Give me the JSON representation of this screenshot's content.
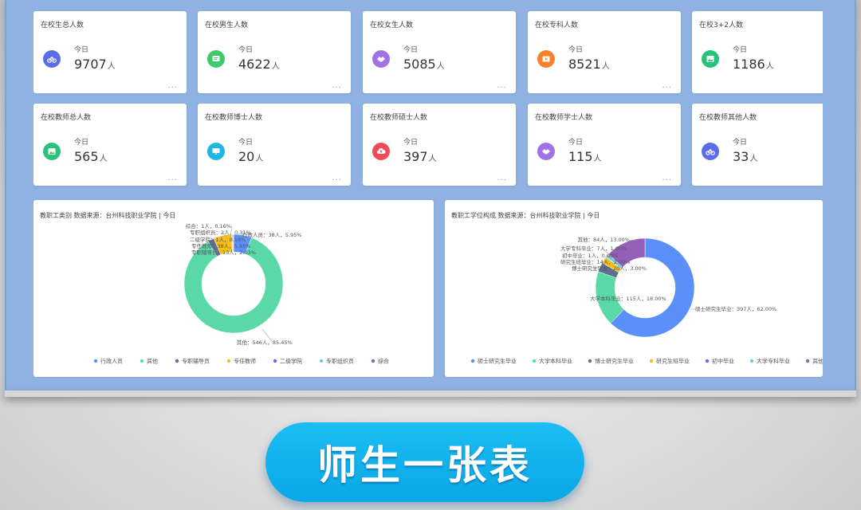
{
  "stats": [
    {
      "title": "在校生总人数",
      "sub": "今日",
      "value": "9707",
      "unit": "人",
      "more": "...",
      "color": "#5b6ee6",
      "icon": "bicycle-icon"
    },
    {
      "title": "在校男生人数",
      "sub": "今日",
      "value": "4622",
      "unit": "人",
      "more": "...",
      "color": "#3ccb6a",
      "icon": "message-icon"
    },
    {
      "title": "在校女生人数",
      "sub": "今日",
      "value": "5085",
      "unit": "人",
      "more": "...",
      "color": "#a271e6",
      "icon": "handshake-icon"
    },
    {
      "title": "在校专科人数",
      "sub": "今日",
      "value": "8521",
      "unit": "人",
      "more": "...",
      "color": "#f7822a",
      "icon": "video-icon"
    },
    {
      "title": "在校3+2人数",
      "sub": "今日",
      "value": "1186",
      "unit": "人",
      "more": "...",
      "color": "#27c27c",
      "icon": "image-icon"
    },
    {
      "title": "在校教师总人数",
      "sub": "今日",
      "value": "565",
      "unit": "人",
      "more": "...",
      "color": "#27c27c",
      "icon": "image-icon"
    },
    {
      "title": "在校教师博士人数",
      "sub": "今日",
      "value": "20",
      "unit": "人",
      "more": "...",
      "color": "#1fb6e6",
      "icon": "monitor-icon"
    },
    {
      "title": "在校教师硕士人数",
      "sub": "今日",
      "value": "397",
      "unit": "人",
      "more": "...",
      "color": "#ee4a57",
      "icon": "cloud-upload-icon"
    },
    {
      "title": "在校教师学士人数",
      "sub": "今日",
      "value": "115",
      "unit": "人",
      "more": "...",
      "color": "#a271e6",
      "icon": "handshake-icon"
    },
    {
      "title": "在校教师其他人数",
      "sub": "今日",
      "value": "33",
      "unit": "人",
      "more": "...",
      "color": "#5b6ee6",
      "icon": "bicycle-icon"
    }
  ],
  "banner": "师生一张表",
  "chart_data": [
    {
      "type": "pie",
      "donut": true,
      "title": "教职工类别 数据来源：台州科技职业学院 | 今日",
      "series": [
        {
          "name": "行政人员",
          "value": 38,
          "label": "行政人员：38人，5.95%",
          "color": "#5b8ff9"
        },
        {
          "name": "其他",
          "value": 546,
          "label": "其他：546人，85.45%",
          "color": "#5ad8a6"
        },
        {
          "name": "专职辅导员",
          "value": 13,
          "label": "专职辅导员：13人，2.03%",
          "color": "#5d7092"
        },
        {
          "name": "专任教师",
          "value": 38,
          "label": "专任教师：38人，5.95%",
          "color": "#f6bd16"
        },
        {
          "name": "二级学院",
          "value": 1,
          "label": "二级学院：1人，0.16%",
          "color": "#7262fd"
        },
        {
          "name": "专职组织员",
          "value": 2,
          "label": "专职组织员：2人，0.31%",
          "color": "#6dc8ec"
        },
        {
          "name": "综合",
          "value": 1,
          "label": "综合：1人，0.16%",
          "color": "#945fb9"
        }
      ]
    },
    {
      "type": "pie",
      "donut": true,
      "title": "教职工学位构成 数据来源：台州科技职业学院 | 今日",
      "series": [
        {
          "name": "硕士研究生毕业",
          "value": 397,
          "label": "硕士研究生毕业：397人，62.00%",
          "color": "#5b8ff9"
        },
        {
          "name": "大学本科毕业",
          "value": 115,
          "label": "大学本科毕业：115人，18.00%",
          "color": "#5ad8a6"
        },
        {
          "name": "博士研究生毕业",
          "value": 20,
          "label": "博士研究生毕业：20人，3.00%",
          "color": "#5d7092"
        },
        {
          "name": "研究生班毕业",
          "value": 14,
          "label": "研究生班毕业：14人，2.00%",
          "color": "#f6bd16"
        },
        {
          "name": "初中毕业",
          "value": 1,
          "label": "初中毕业：1人，0.00%",
          "color": "#7262fd"
        },
        {
          "name": "大学专科毕业",
          "value": 7,
          "label": "大学专科毕业：7人，1.00%",
          "color": "#6dc8ec"
        },
        {
          "name": "其他",
          "value": 84,
          "label": "其他：84人，13.00%",
          "color": "#945fb9"
        }
      ]
    }
  ]
}
